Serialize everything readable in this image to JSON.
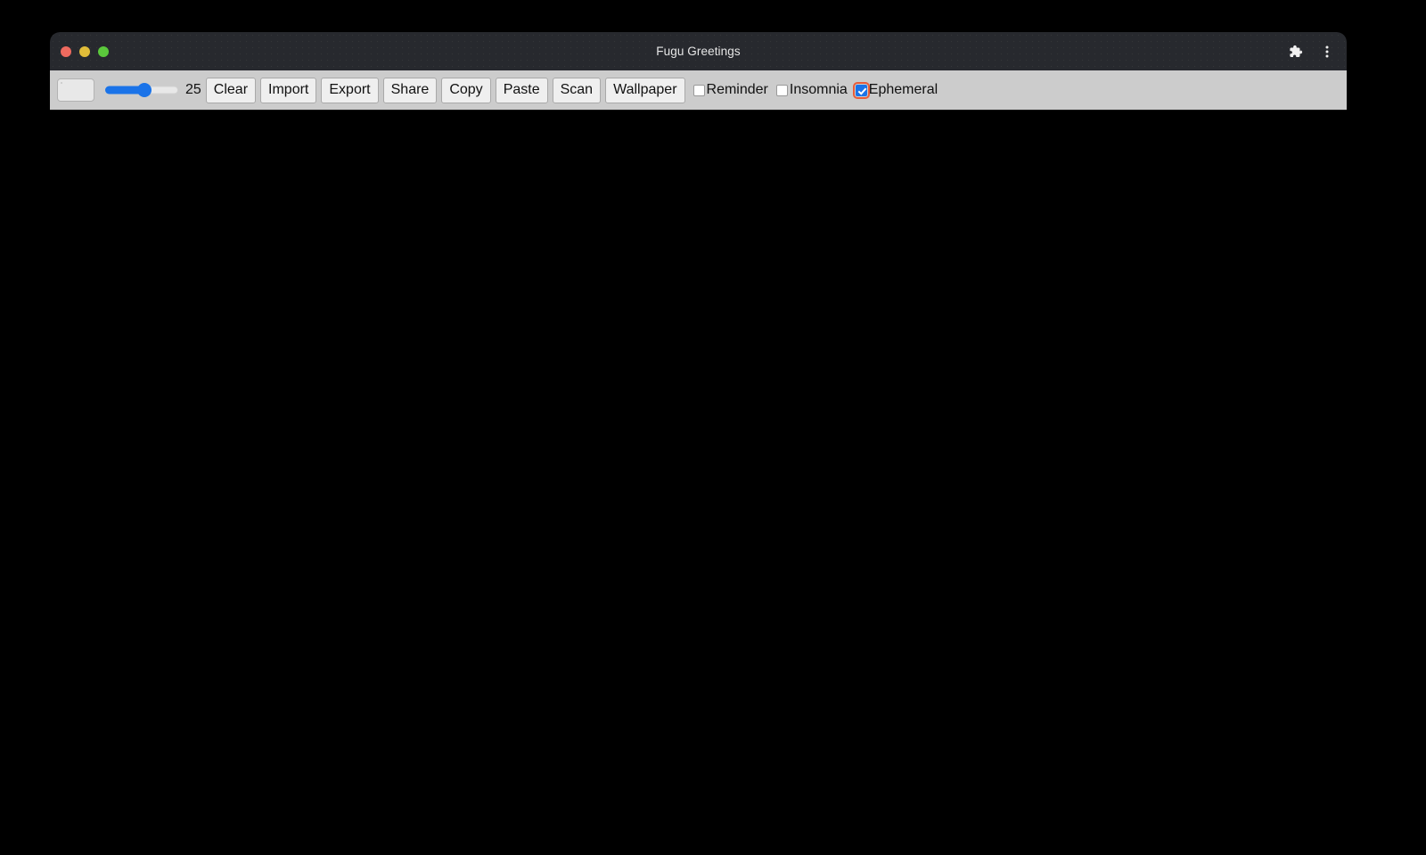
{
  "window": {
    "title": "Fugu Greetings",
    "traffic_lights": [
      {
        "name": "close",
        "color": "#ee6a5f"
      },
      {
        "name": "minimize",
        "color": "#e0bc39"
      },
      {
        "name": "maximize",
        "color": "#5bc93c"
      }
    ],
    "actions": [
      {
        "name": "extensions-icon",
        "label": "Extensions"
      },
      {
        "name": "more-menu-icon",
        "label": "More"
      }
    ]
  },
  "toolbar": {
    "color_picker": {
      "name": "color-input",
      "value": "#f4f4f4"
    },
    "slider": {
      "name": "line-width-slider",
      "value": 25,
      "min": 0,
      "max": 50,
      "display_value": "25",
      "fill_color": "#1a73e8"
    },
    "buttons": [
      {
        "name": "clear-button",
        "label": "Clear"
      },
      {
        "name": "import-button",
        "label": "Import"
      },
      {
        "name": "export-button",
        "label": "Export"
      },
      {
        "name": "share-button",
        "label": "Share"
      },
      {
        "name": "copy-button",
        "label": "Copy"
      },
      {
        "name": "paste-button",
        "label": "Paste"
      },
      {
        "name": "scan-button",
        "label": "Scan"
      },
      {
        "name": "wallpaper-button",
        "label": "Wallpaper"
      }
    ],
    "checkboxes": [
      {
        "name": "reminder-checkbox",
        "label": "Reminder",
        "checked": false,
        "focused": false
      },
      {
        "name": "insomnia-checkbox",
        "label": "Insomnia",
        "checked": false,
        "focused": false
      },
      {
        "name": "ephemeral-checkbox",
        "label": "Ephemeral",
        "checked": true,
        "focused": true
      }
    ]
  },
  "canvas": {
    "name": "drawing-canvas",
    "background_color": "#000000"
  }
}
